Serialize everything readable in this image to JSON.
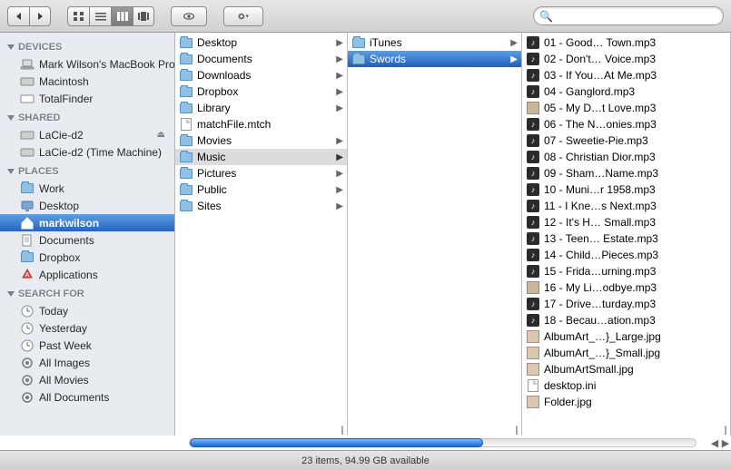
{
  "search": {
    "placeholder": ""
  },
  "sidebar": {
    "groups": [
      {
        "label": "DEVICES",
        "items": [
          {
            "name": "Mark Wilson's MacBook Pro",
            "icon": "laptop"
          },
          {
            "name": "Macintosh",
            "icon": "hdd"
          },
          {
            "name": "TotalFinder",
            "icon": "hdd-white"
          }
        ]
      },
      {
        "label": "SHARED",
        "items": [
          {
            "name": "LaCie-d2",
            "icon": "hdd-ext",
            "eject": true
          },
          {
            "name": "LaCie-d2 (Time Machine)",
            "icon": "hdd-ext"
          }
        ]
      },
      {
        "label": "PLACES",
        "items": [
          {
            "name": "Work",
            "icon": "folder"
          },
          {
            "name": "Desktop",
            "icon": "desktop"
          },
          {
            "name": "markwilson",
            "icon": "home",
            "selected": true
          },
          {
            "name": "Documents",
            "icon": "documents"
          },
          {
            "name": "Dropbox",
            "icon": "folder"
          },
          {
            "name": "Applications",
            "icon": "apps"
          }
        ]
      },
      {
        "label": "SEARCH FOR",
        "items": [
          {
            "name": "Today",
            "icon": "clock"
          },
          {
            "name": "Yesterday",
            "icon": "clock"
          },
          {
            "name": "Past Week",
            "icon": "clock"
          },
          {
            "name": "All Images",
            "icon": "smart"
          },
          {
            "name": "All Movies",
            "icon": "smart"
          },
          {
            "name": "All Documents",
            "icon": "smart"
          }
        ]
      }
    ]
  },
  "columns": [
    {
      "items": [
        {
          "name": "Desktop",
          "type": "folder",
          "children": true
        },
        {
          "name": "Documents",
          "type": "folder",
          "children": true
        },
        {
          "name": "Downloads",
          "type": "folder",
          "children": true
        },
        {
          "name": "Dropbox",
          "type": "folder",
          "children": true
        },
        {
          "name": "Library",
          "type": "folder",
          "children": true
        },
        {
          "name": "matchFile.mtch",
          "type": "file"
        },
        {
          "name": "Movies",
          "type": "folder",
          "children": true
        },
        {
          "name": "Music",
          "type": "folder",
          "children": true,
          "highlight": true
        },
        {
          "name": "Pictures",
          "type": "folder",
          "children": true
        },
        {
          "name": "Public",
          "type": "folder",
          "children": true
        },
        {
          "name": "Sites",
          "type": "folder",
          "children": true
        }
      ]
    },
    {
      "items": [
        {
          "name": "iTunes",
          "type": "folder",
          "children": true
        },
        {
          "name": "Swords",
          "type": "folder",
          "children": true,
          "selected": true
        }
      ]
    },
    {
      "items": [
        {
          "name": "01 - Good… Town.mp3",
          "type": "audio"
        },
        {
          "name": "02 - Don't… Voice.mp3",
          "type": "audio"
        },
        {
          "name": "03 - If You…At Me.mp3",
          "type": "audio"
        },
        {
          "name": "04 - Ganglord.mp3",
          "type": "audio"
        },
        {
          "name": "05 - My D…t Love.mp3",
          "type": "image"
        },
        {
          "name": "06 - The N…onies.mp3",
          "type": "audio"
        },
        {
          "name": "07 - Sweetie-Pie.mp3",
          "type": "audio"
        },
        {
          "name": "08 - Christian Dior.mp3",
          "type": "audio"
        },
        {
          "name": "09 - Sham…Name.mp3",
          "type": "audio"
        },
        {
          "name": "10 - Muni…r 1958.mp3",
          "type": "audio"
        },
        {
          "name": "11 - I Kne…s Next.mp3",
          "type": "audio"
        },
        {
          "name": "12 - It's H… Small.mp3",
          "type": "audio"
        },
        {
          "name": "13 - Teen… Estate.mp3",
          "type": "audio"
        },
        {
          "name": "14 - Child…Pieces.mp3",
          "type": "audio"
        },
        {
          "name": "15 - Frida…urning.mp3",
          "type": "audio"
        },
        {
          "name": "16 - My Li…odbye.mp3",
          "type": "image"
        },
        {
          "name": "17 - Drive…turday.mp3",
          "type": "audio"
        },
        {
          "name": "18 - Becau…ation.mp3",
          "type": "audio"
        },
        {
          "name": "AlbumArt_…}_Large.jpg",
          "type": "jpg"
        },
        {
          "name": "AlbumArt_…}_Small.jpg",
          "type": "jpg"
        },
        {
          "name": "AlbumArtSmall.jpg",
          "type": "jpg"
        },
        {
          "name": "desktop.ini",
          "type": "doc"
        },
        {
          "name": "Folder.jpg",
          "type": "jpg"
        }
      ]
    }
  ],
  "status": "23 items, 94.99 GB available"
}
